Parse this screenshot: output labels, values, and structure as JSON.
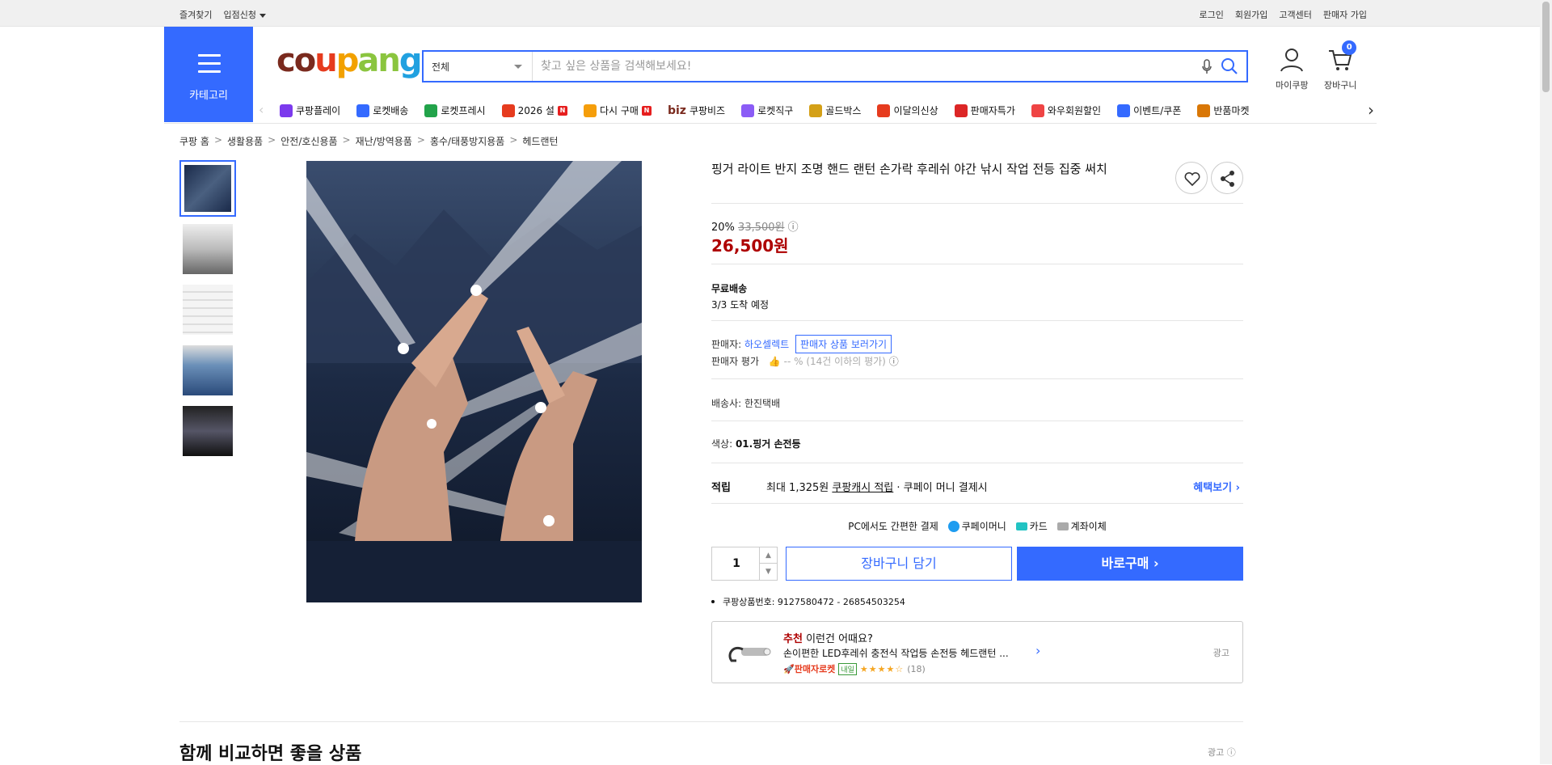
{
  "topbar": {
    "left": [
      "즐겨찾기",
      "입점신청"
    ],
    "right": [
      "로그인",
      "회원가입",
      "고객센터",
      "판매자 가입"
    ]
  },
  "category_button": {
    "label": "카테고리"
  },
  "logo": {
    "parts": [
      "c",
      "o",
      "u",
      "p",
      "a",
      "n",
      "g"
    ]
  },
  "search": {
    "category_value": "전체",
    "placeholder": "찾고 싶은 상품을 검색해보세요!"
  },
  "header_icons": {
    "mycoupang": "마이쿠팡",
    "cart": "장바구니",
    "cart_count": "0"
  },
  "category_nav": [
    {
      "label": "쿠팡플레이",
      "icon": "play-icon",
      "color": "#7c3aed"
    },
    {
      "label": "로켓배송",
      "icon": "rocket-icon",
      "color": "#346aff"
    },
    {
      "label": "로켓프레시",
      "icon": "rocket-fresh-icon",
      "color": "#22a34a"
    },
    {
      "label": "2026 설",
      "icon": "gift-icon",
      "color": "#e63b1e",
      "badge": "N"
    },
    {
      "label": "다시 구매",
      "icon": "repurchase-icon",
      "color": "#f59e0b",
      "badge": "N"
    },
    {
      "label": "쿠팡비즈",
      "icon": "biz-icon",
      "color": "#7a2a1e",
      "prefix": "biz"
    },
    {
      "label": "로켓직구",
      "icon": "global-icon",
      "color": "#8b5cf6"
    },
    {
      "label": "골드박스",
      "icon": "goldbox-icon",
      "color": "#d4a017"
    },
    {
      "label": "이달의신상",
      "icon": "new-icon",
      "color": "#e63b1e"
    },
    {
      "label": "판매자특가",
      "icon": "sale-icon",
      "color": "#dc2626"
    },
    {
      "label": "와우회원할인",
      "icon": "wow-icon",
      "color": "#ef4444"
    },
    {
      "label": "이벤트/쿠폰",
      "icon": "coupon-icon",
      "color": "#346aff"
    },
    {
      "label": "반품마켓",
      "icon": "return-icon",
      "color": "#d97706"
    }
  ],
  "breadcrumb": [
    "쿠팡 홈",
    "생활용품",
    "안전/호신용품",
    "재난/방역용품",
    "홍수/태풍방지용품",
    "헤드랜턴"
  ],
  "product": {
    "title": "핑거 라이트 반지 조명 핸드 랜턴 손가락 후레쉬 야간 낚시 작업 전등 집중 써치",
    "discount": "20%",
    "original_price": "33,500원",
    "price": "26,500원",
    "shipping_title": "무료배송",
    "shipping_eta": "3/3 도착 예정",
    "seller_label": "판매자:",
    "seller_name": "하오셀렉트",
    "seller_link": "판매자 상품 보러가기",
    "seller_rating_label": "판매자 평가",
    "seller_rating_value": "-- %",
    "seller_rating_note": "(14건 이하의 평가)",
    "carrier": "배송사:  한진택배",
    "color_label": "색상:",
    "color_value": "01.핑거 손전등",
    "earn_label": "적립",
    "earn_value_pre": "최대 1,325원",
    "earn_value_link": "쿠팡캐시 적립",
    "earn_value_post": "· 쿠페이 머니 결제시",
    "earn_more": "혜택보기",
    "pay_title": "PC에서도 간편한 결제",
    "pay_methods": [
      "쿠페이머니",
      "카드",
      "계좌이체"
    ],
    "quantity": "1",
    "cart_button": "장바구니 담기",
    "buy_button": "바로구매",
    "product_id": "쿠팡상품번호: 9127580472 - 26854503254"
  },
  "recommend": {
    "heading_strong": "추천",
    "heading": "이런건 어때요?",
    "title": "손이편한 LED후레쉬 충전식 작업등 손전등 헤드랜턴 ...",
    "seller_rocket": "판매자로켓",
    "tomorrow": "내일",
    "stars": "★★★★☆",
    "rating": 4,
    "review_count": "(18)",
    "ad": "광고"
  },
  "compare": {
    "title": "함께 비교하면 좋을 상품",
    "ad": "광고"
  },
  "colors": {
    "accent": "#346aff",
    "price": "#ae0000"
  }
}
